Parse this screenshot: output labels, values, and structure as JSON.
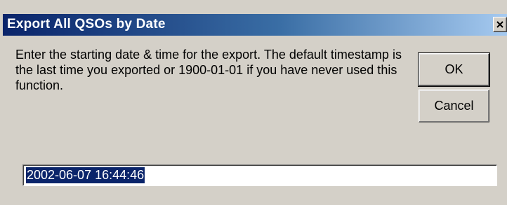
{
  "window": {
    "title": "Export All QSOs by Date",
    "close_icon": "close-icon"
  },
  "message": "Enter the starting date & time for the export. The default timestamp is the last time you exported or 1900-01-01 if you have never used this function.",
  "buttons": {
    "ok_label": "OK",
    "cancel_label": "Cancel"
  },
  "date_input": {
    "value": "2002-06-07 16:44:46",
    "selected": true
  },
  "colors": {
    "title_bar_start": "#0a246a",
    "title_bar_end": "#a6caf0",
    "dialog_face": "#d4d0c8",
    "selection_highlight": "#0a246a"
  }
}
